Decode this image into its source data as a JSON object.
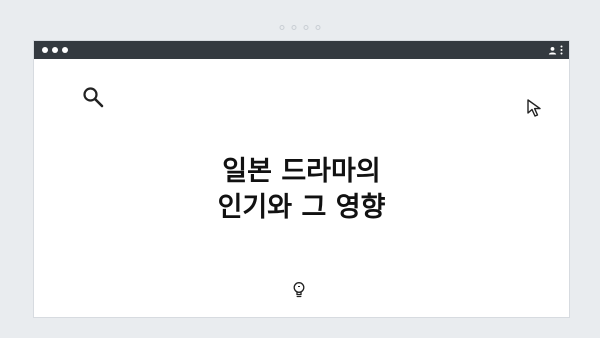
{
  "pager": {
    "count": 4
  },
  "window": {
    "title_lines": [
      "일본 드라마의",
      "인기와 그 영향"
    ]
  },
  "icons": {
    "search": "search-icon",
    "cursor": "cursor-icon",
    "lightbulb": "lightbulb-icon",
    "account": "account-icon",
    "more": "more-vert-icon"
  },
  "colors": {
    "background": "#e9ecef",
    "titlebar": "#343a40",
    "text": "#111111"
  }
}
